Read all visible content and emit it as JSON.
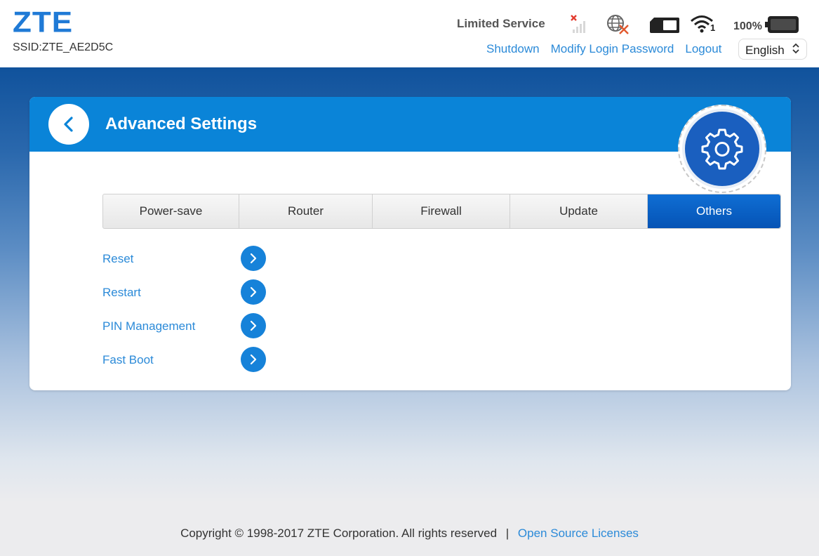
{
  "header": {
    "logo": "ZTE",
    "ssid": "SSID:ZTE_AE2D5C",
    "network_status": "Limited Service",
    "wifi_clients": "1",
    "battery_percent": "100%",
    "links": {
      "shutdown": "Shutdown",
      "modify_password": "Modify Login Password",
      "logout": "Logout"
    },
    "language": "English"
  },
  "card": {
    "title": "Advanced Settings",
    "tabs": [
      {
        "label": "Power-save",
        "active": false
      },
      {
        "label": "Router",
        "active": false
      },
      {
        "label": "Firewall",
        "active": false
      },
      {
        "label": "Update",
        "active": false
      },
      {
        "label": "Others",
        "active": true
      }
    ],
    "items": [
      {
        "label": "Reset"
      },
      {
        "label": "Restart"
      },
      {
        "label": "PIN Management"
      },
      {
        "label": "Fast Boot"
      }
    ]
  },
  "footer": {
    "copyright": "Copyright © 1998-2017 ZTE Corporation. All rights reserved",
    "separator": "|",
    "license_link": "Open Source Licenses"
  },
  "colors": {
    "brand": "#1f7ad6",
    "link": "#2b8ad8",
    "header_bar": "#0a84d8",
    "active_tab": "#0553b5"
  },
  "icons": [
    "signal-icon",
    "globe-icon",
    "sim-icon",
    "wifi-icon",
    "battery-icon",
    "chevron-left-icon",
    "gear-icon",
    "chevron-right-icon"
  ]
}
